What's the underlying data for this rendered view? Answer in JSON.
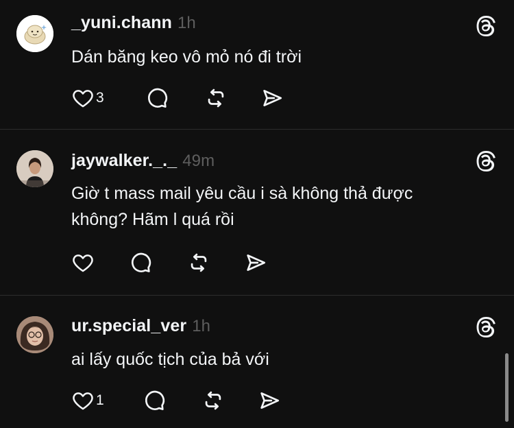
{
  "posts": [
    {
      "username": "_yuni.chann",
      "time": "1h",
      "text": "Dán băng keo vô mỏ nó đi trời",
      "likes": "3"
    },
    {
      "username": "jaywalker._._",
      "time": "49m",
      "text": "Giờ t mass mail yêu cầu i sà không thả được\nkhông? Hãm l quá rồi",
      "likes": ""
    },
    {
      "username": "ur.special_ver",
      "time": "1h",
      "text": "ai lấy quốc tịch của bả với",
      "likes": "1"
    }
  ],
  "icons": {
    "like": "heart-icon",
    "comment": "comment-icon",
    "repost": "repost-icon",
    "share": "send-icon",
    "brand": "threads-icon"
  },
  "colors": {
    "background": "#101010",
    "text": "#f3f5f7",
    "muted": "#5e5e5e",
    "divider": "#2d2d2d"
  }
}
